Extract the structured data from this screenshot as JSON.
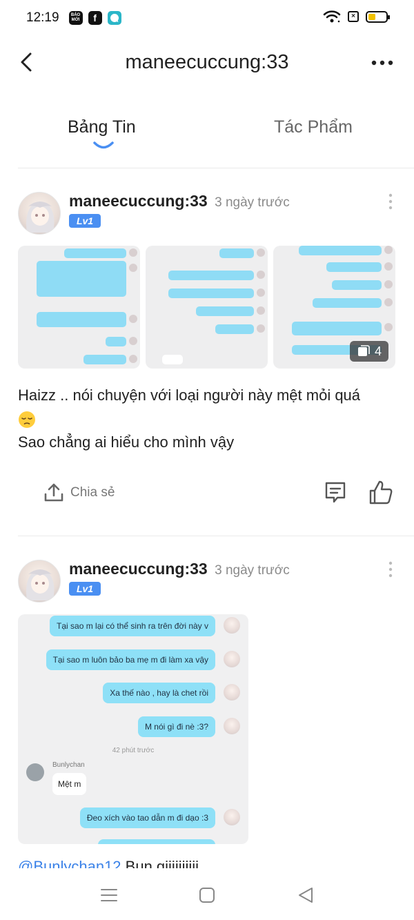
{
  "status_bar": {
    "time": "12:19",
    "apps": [
      "BÁO MỚI",
      "f",
      "messenger"
    ]
  },
  "header": {
    "title": "maneecuccung:33"
  },
  "tabs": [
    {
      "label": "Bảng Tin",
      "active": true
    },
    {
      "label": "Tác Phẩm",
      "active": false
    }
  ],
  "posts": [
    {
      "user": "maneecuccung:33",
      "time": "3 ngày trước",
      "level": "Lv1",
      "image_count": "4",
      "text_line1": "Haizz .. nói chuyện với loại người này mệt mỏi quá",
      "emoji": "😔",
      "text_line2": "Sao chẳng ai hiểu cho mình vậy",
      "share_label": "Chia sẻ"
    },
    {
      "user": "maneecuccung:33",
      "time": "3 ngày trước",
      "level": "Lv1",
      "chat": {
        "messages_right": [
          "Tại sao m lại có thể sinh ra trên đời này v",
          "Tại sao m luôn bảo ba mẹ m đi làm xa vậy",
          "Xa thế nào , hay là chet rồi",
          "M nói gì đi nè :3?"
        ],
        "time_divider": "42 phút trước",
        "other_name": "Bunlychan",
        "other_message": "Mệt m",
        "last_message": "Đeo xích vào tao dẫn m đi dạo :3"
      },
      "mention": "@Bunlychan12",
      "text_after": " Bun giiiiiiiiii"
    }
  ],
  "colors": {
    "accent": "#4a8ff2",
    "bubble": "#8ee0f7",
    "mention": "#3b82e8"
  }
}
